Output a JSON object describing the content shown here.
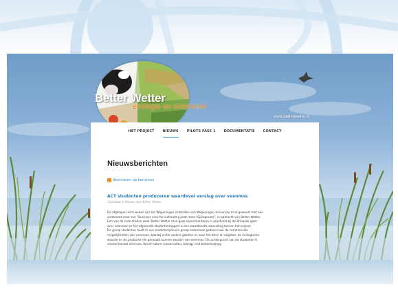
{
  "site": {
    "title": "Better Wetter",
    "subtitle": "ecologie en economie",
    "url": "www.betterwetter.nl"
  },
  "nav": {
    "items": [
      {
        "label": "HET PROJECT"
      },
      {
        "label": "NIEUWS"
      },
      {
        "label": "PILOTS FASE 1"
      },
      {
        "label": "DOCUMENTATIE"
      },
      {
        "label": "CONTACT"
      }
    ],
    "active_index": 1
  },
  "page": {
    "title": "Nieuwsberichten",
    "rss_label": "Abonneren op berichten"
  },
  "article": {
    "title": "ACT studenten produceren waardevol verslag over veenmos",
    "meta": "Geplaatst in Nieuws door Better Wetter",
    "body_lines": [
      "De afgelopen acht weken zijn zes Wageningse studenten van Wageningen University druk geweest met een",
      "onderzoek naar een \"Business case for cultivating peat moss (Sphagnum)\", in opdracht van Better Wetter.",
      "Een van de rode draden waar Better Wetter mee gaat experimenteren in proefveld bij de Brilaplak gaat",
      "over veenmos en het afgeronde studentenrapport is een waardevolle aanvulling binnen het project.",
      "De group studenten heeft in een multidisciplinaire groep onderzoek gedaan naar de commerciële",
      "mogelijkheden van veenmos, waarbij onder andere gekeken is naar het telen en oogsten, de ecologische",
      "waarde en de productie die gemaakt kunnen worden van veenmos. De achtergrond van de studenten is",
      "environmental sciences, forest-nature conservation, biology and biotechnology."
    ]
  },
  "colors": {
    "accent": "#49a0cf",
    "article_title": "#2e7fb8",
    "logo_subtitle": "#e8871f",
    "rss": "#f28a1c"
  }
}
